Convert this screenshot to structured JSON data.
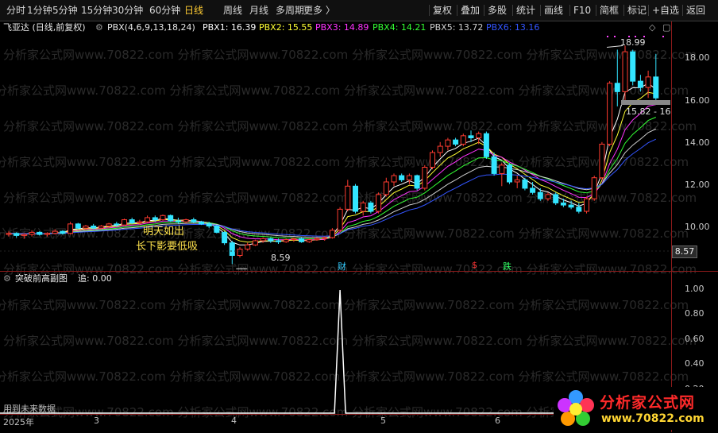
{
  "toolbar": {
    "periods": [
      "分时",
      "1分钟",
      "5分钟",
      "15分钟",
      "30分钟",
      "60分钟",
      "日线",
      "周线",
      "月线",
      "多周期",
      "更多 〉"
    ],
    "active_period": "日线",
    "actions": [
      "复权",
      "叠加",
      "多股",
      "统计",
      "画线",
      "F10",
      "简框",
      "标记",
      "+自选",
      "返回"
    ]
  },
  "infobar": {
    "stock": "飞亚达 (日线,前复权)",
    "indicator": "PBX(4,6,9,13,18,24)",
    "pbx1": "PBX1: 16.39",
    "pbx2": "PBX2: 15.55",
    "pbx3": "PBX3: 14.89",
    "pbx4": "PBX4: 14.21",
    "pbx5": "PBX5: 13.72",
    "pbx6": "PBX6: 13.16"
  },
  "colors": {
    "up": "#ff3b30",
    "down": "#33e5ff",
    "pbx1": "#ffffff",
    "pbx2": "#ffff33",
    "pbx3": "#ff33ff",
    "pbx4": "#33ff33",
    "pbx5": "#d0d0d0",
    "pbx6": "#3355ff"
  },
  "price_axis": [
    "18.00",
    "16.00",
    "14.00",
    "12.00",
    "10.00"
  ],
  "price_box": "8.57",
  "annotations": {
    "high": "18.99",
    "low": "8.59",
    "range": "15.82 - 16",
    "tip_line1": "明天如出",
    "tip_line2": "长下影要低吸",
    "marker_cai": "财",
    "marker_s": "$",
    "marker_die": "跌"
  },
  "sub_indicator": {
    "name": "突破前高副图",
    "value": "追: 0.00",
    "note": "用到未来数据"
  },
  "sub_axis": [
    "1.00",
    "0.80",
    "0.60",
    "0.40",
    "0.20"
  ],
  "time_axis": {
    "year": "2025年",
    "months": [
      "3",
      "4",
      "5",
      "6"
    ]
  },
  "watermark": "分析家公式网www.70822.com",
  "logo": {
    "title": "分析家公式网",
    "url": "www.70822.com"
  },
  "chart_data": {
    "type": "candlestick",
    "ylim": [
      8.3,
      19.5
    ],
    "candles": [
      [
        10.0,
        10.15,
        9.9,
        10.05
      ],
      [
        10.05,
        10.1,
        9.85,
        9.95
      ],
      [
        9.95,
        10.05,
        9.8,
        10.0
      ],
      [
        10.0,
        10.2,
        9.9,
        10.1
      ],
      [
        10.1,
        10.15,
        9.95,
        10.0
      ],
      [
        10.0,
        10.1,
        9.9,
        10.05
      ],
      [
        10.05,
        10.25,
        10.0,
        10.15
      ],
      [
        10.15,
        10.2,
        10.0,
        10.05
      ],
      [
        10.05,
        10.6,
        10.0,
        10.5
      ],
      [
        10.5,
        10.55,
        10.25,
        10.3
      ],
      [
        10.3,
        10.45,
        10.2,
        10.4
      ],
      [
        10.4,
        10.5,
        10.25,
        10.3
      ],
      [
        10.3,
        10.45,
        10.25,
        10.4
      ],
      [
        10.4,
        10.55,
        10.3,
        10.5
      ],
      [
        10.5,
        10.6,
        10.35,
        10.45
      ],
      [
        10.45,
        10.75,
        10.4,
        10.7
      ],
      [
        10.7,
        10.8,
        10.5,
        10.55
      ],
      [
        10.55,
        10.7,
        10.45,
        10.6
      ],
      [
        10.6,
        10.9,
        10.55,
        10.8
      ],
      [
        10.8,
        10.9,
        10.6,
        10.7
      ],
      [
        10.7,
        10.95,
        10.65,
        10.9
      ],
      [
        10.9,
        10.95,
        10.6,
        10.65
      ],
      [
        10.65,
        10.8,
        10.5,
        10.6
      ],
      [
        10.6,
        10.75,
        10.55,
        10.7
      ],
      [
        10.7,
        10.8,
        10.55,
        10.6
      ],
      [
        10.6,
        10.65,
        10.45,
        10.5
      ],
      [
        10.5,
        10.6,
        10.3,
        10.4
      ],
      [
        10.4,
        10.45,
        10.05,
        10.1
      ],
      [
        10.1,
        10.15,
        9.5,
        9.6
      ],
      [
        9.6,
        9.7,
        8.59,
        9.0
      ],
      [
        9.0,
        9.4,
        8.9,
        9.3
      ],
      [
        9.3,
        9.6,
        9.2,
        9.5
      ],
      [
        9.5,
        9.75,
        9.45,
        9.7
      ],
      [
        9.7,
        9.85,
        9.6,
        9.8
      ],
      [
        9.8,
        9.85,
        9.6,
        9.7
      ],
      [
        9.7,
        9.8,
        9.55,
        9.65
      ],
      [
        9.65,
        9.8,
        9.6,
        9.75
      ],
      [
        9.75,
        9.85,
        9.65,
        9.8
      ],
      [
        9.8,
        9.85,
        9.6,
        9.65
      ],
      [
        9.65,
        9.8,
        9.6,
        9.75
      ],
      [
        9.75,
        9.85,
        9.7,
        9.8
      ],
      [
        9.8,
        9.9,
        9.7,
        9.85
      ],
      [
        9.85,
        10.3,
        9.8,
        10.2
      ],
      [
        10.2,
        11.3,
        10.1,
        11.2
      ],
      [
        11.2,
        12.6,
        11.1,
        12.3
      ],
      [
        12.3,
        12.4,
        11.0,
        11.1
      ],
      [
        11.1,
        11.6,
        10.9,
        11.5
      ],
      [
        11.5,
        11.6,
        11.0,
        11.1
      ],
      [
        11.1,
        12.0,
        11.0,
        11.9
      ],
      [
        11.9,
        12.7,
        11.8,
        12.5
      ],
      [
        12.5,
        12.9,
        12.3,
        12.8
      ],
      [
        12.8,
        12.9,
        12.5,
        12.6
      ],
      [
        12.6,
        12.9,
        12.4,
        12.8
      ],
      [
        12.8,
        12.85,
        12.1,
        12.2
      ],
      [
        12.2,
        13.3,
        12.1,
        13.2
      ],
      [
        13.2,
        14.0,
        13.1,
        13.9
      ],
      [
        13.9,
        14.4,
        13.7,
        14.2
      ],
      [
        14.2,
        14.6,
        14.0,
        14.5
      ],
      [
        14.5,
        14.6,
        14.2,
        14.3
      ],
      [
        14.3,
        14.8,
        14.2,
        14.7
      ],
      [
        14.7,
        14.95,
        14.4,
        14.6
      ],
      [
        14.6,
        14.9,
        14.3,
        14.8
      ],
      [
        14.8,
        14.9,
        13.6,
        13.7
      ],
      [
        13.7,
        13.9,
        12.8,
        12.9
      ],
      [
        12.9,
        13.4,
        12.3,
        13.3
      ],
      [
        13.3,
        13.4,
        12.4,
        12.5
      ],
      [
        12.5,
        12.8,
        12.2,
        12.6
      ],
      [
        12.6,
        12.7,
        12.1,
        12.2
      ],
      [
        12.2,
        12.5,
        11.9,
        12.0
      ],
      [
        12.0,
        12.2,
        11.6,
        11.7
      ],
      [
        11.7,
        12.0,
        11.6,
        11.9
      ],
      [
        11.9,
        12.0,
        11.4,
        11.5
      ],
      [
        11.5,
        11.7,
        11.3,
        11.4
      ],
      [
        11.4,
        11.6,
        11.2,
        11.3
      ],
      [
        11.3,
        11.5,
        11.0,
        11.1
      ],
      [
        11.1,
        11.8,
        11.0,
        11.7
      ],
      [
        11.7,
        12.8,
        11.6,
        12.7
      ],
      [
        12.7,
        14.4,
        12.6,
        14.3
      ],
      [
        14.3,
        17.3,
        14.2,
        17.2
      ],
      [
        17.2,
        18.8,
        16.1,
        16.8
      ],
      [
        16.8,
        18.99,
        16.3,
        18.7
      ],
      [
        18.7,
        18.8,
        17.1,
        17.3
      ],
      [
        17.3,
        17.6,
        16.8,
        17.0
      ],
      [
        17.0,
        17.8,
        16.5,
        17.5
      ],
      [
        17.5,
        18.6,
        16.4,
        16.5
      ]
    ],
    "signal_index": 43
  }
}
